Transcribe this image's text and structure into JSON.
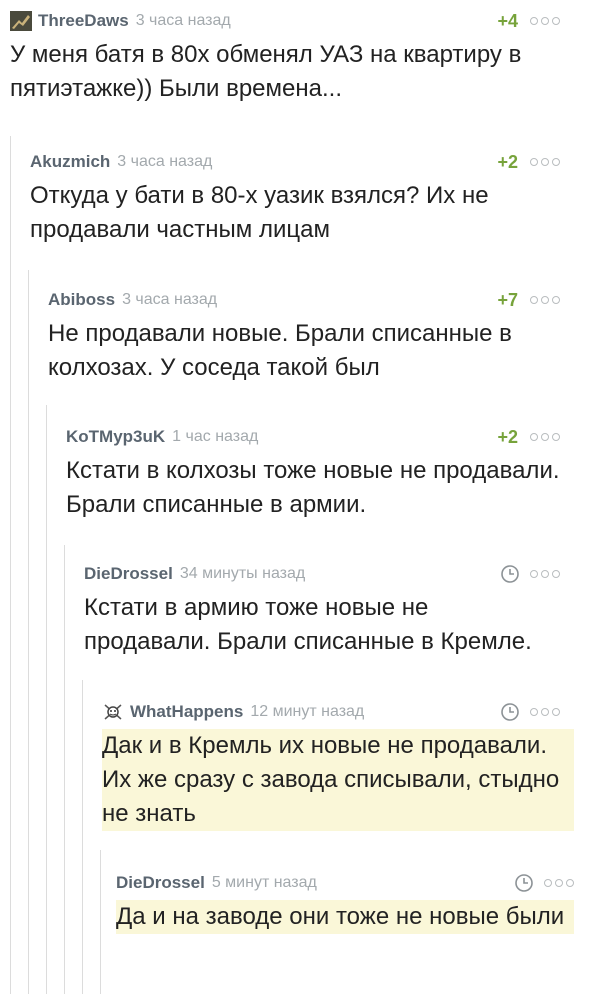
{
  "comments": [
    {
      "author": "ThreeDaws",
      "time": "3 часа назад",
      "rating": "+4",
      "text": "У меня батя в 80х обменял УАЗ на квартиру в пятиэтажке)) Были времена..."
    },
    {
      "author": "Akuzmich",
      "time": "3 часа назад",
      "rating": "+2",
      "text": "Откуда у бати в 80-х уазик взялся? Их не продавали частным лицам"
    },
    {
      "author": "Abiboss",
      "time": "3 часа назад",
      "rating": "+7",
      "text": "Не продавали новые. Брали списанные в колхозах. У соседа такой был"
    },
    {
      "author": "KoTMyp3uK",
      "time": "1 час назад",
      "rating": "+2",
      "text": "Кстати в колхозы тоже новые не продавали. Брали списанные в армии."
    },
    {
      "author": "DieDrossel",
      "time": "34 минуты назад",
      "rating": "",
      "text": "Кстати в армию тоже новые не продавали. Брали списанные в Кремле."
    },
    {
      "author": "WhatHappens",
      "time": "12 минут назад",
      "rating": "",
      "text": "Дак и в Кремль их новые не продавали. Их же сразу с завода списывали, стыдно не знать"
    },
    {
      "author": "DieDrossel",
      "time": "5 минут назад",
      "rating": "",
      "text": "Да и на заводе они тоже не новые были"
    }
  ],
  "colors": {
    "rating": "#77a33b",
    "highlight": "#faf7d8",
    "author": "#5a6570",
    "time": "#a3a9ad"
  }
}
